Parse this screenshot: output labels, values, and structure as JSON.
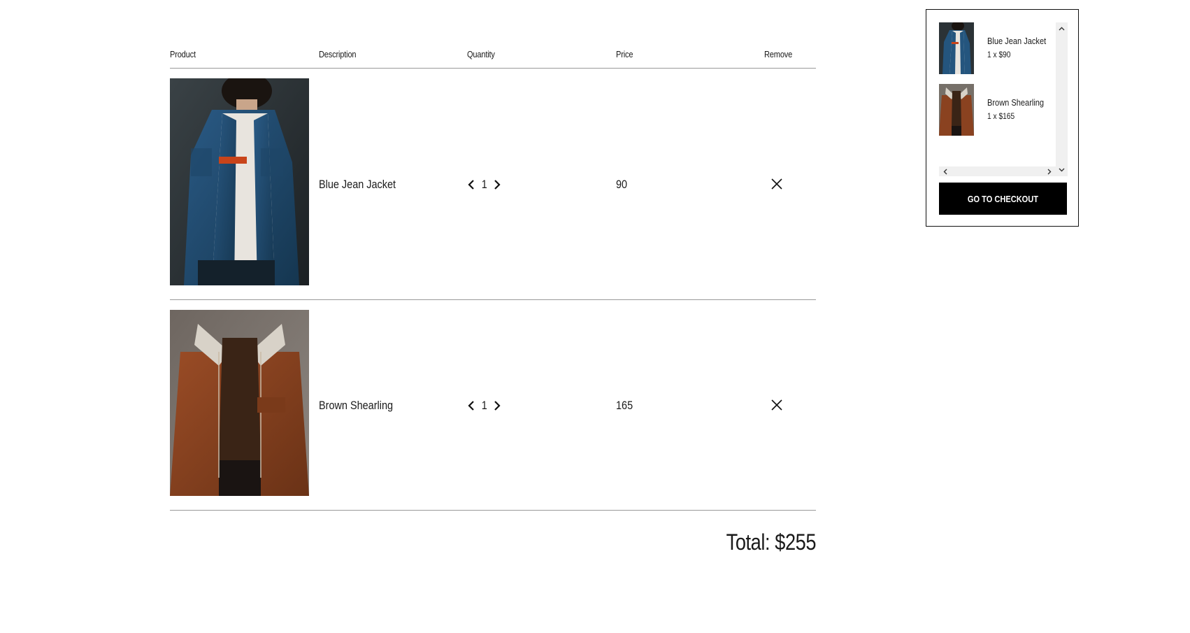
{
  "table": {
    "headers": {
      "product": "Product",
      "description": "Description",
      "quantity": "Quantity",
      "price": "Price",
      "remove": "Remove"
    },
    "rows": [
      {
        "image": "blue-jean-jacket-photo",
        "description": "Blue Jean Jacket",
        "quantity": "1",
        "price": "90"
      },
      {
        "image": "brown-shearling-jacket-photo",
        "description": "Brown Shearling",
        "quantity": "1",
        "price": "165"
      }
    ]
  },
  "total": {
    "label": "Total: $255"
  },
  "mini_cart": {
    "items": [
      {
        "name": "Blue Jean Jacket",
        "qty_line": "1 x $90"
      },
      {
        "name": "Brown Shearling",
        "qty_line": "1 x $165"
      }
    ],
    "checkout_label": "GO TO CHECKOUT"
  },
  "colors": {
    "divider": "#999999",
    "checkout_bg": "#000000",
    "denim": "#1f4a73",
    "suede": "#8a4220"
  }
}
